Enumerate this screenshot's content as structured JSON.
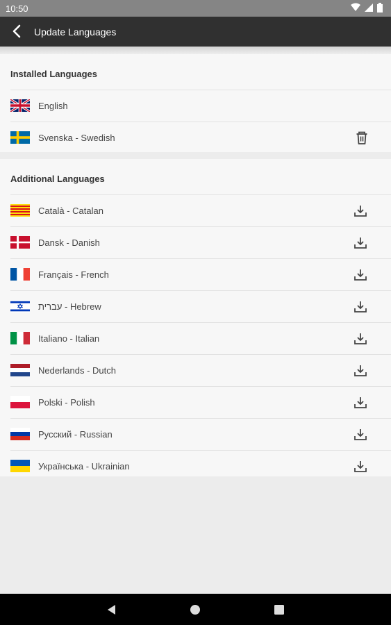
{
  "status_bar": {
    "time": "10:50"
  },
  "app_bar": {
    "title": "Update Languages"
  },
  "installed": {
    "title": "Installed Languages",
    "items": [
      {
        "label": "English",
        "flag": "uk-flag-icon"
      },
      {
        "label": "Svenska - Swedish",
        "flag": "sweden-flag-icon",
        "action": "delete-icon"
      }
    ]
  },
  "additional": {
    "title": "Additional Languages",
    "items": [
      {
        "label": "Català - Catalan",
        "flag": "catalonia-flag-icon",
        "action": "download-icon"
      },
      {
        "label": "Dansk - Danish",
        "flag": "denmark-flag-icon",
        "action": "download-icon"
      },
      {
        "label": "Français - French",
        "flag": "france-flag-icon",
        "action": "download-icon"
      },
      {
        "label": "עברית - Hebrew",
        "flag": "israel-flag-icon",
        "action": "download-icon"
      },
      {
        "label": "Italiano - Italian",
        "flag": "italy-flag-icon",
        "action": "download-icon"
      },
      {
        "label": "Nederlands - Dutch",
        "flag": "netherlands-flag-icon",
        "action": "download-icon"
      },
      {
        "label": "Polski - Polish",
        "flag": "poland-flag-icon",
        "action": "download-icon"
      },
      {
        "label": "Русский - Russian",
        "flag": "russia-flag-icon",
        "action": "download-icon"
      },
      {
        "label": "Українська - Ukrainian",
        "flag": "ukraine-flag-icon",
        "action": "download-icon"
      }
    ]
  },
  "colors": {
    "app_bar": "#303030",
    "status_bar": "#858585",
    "background": "#ececec",
    "card": "#f7f7f7"
  }
}
